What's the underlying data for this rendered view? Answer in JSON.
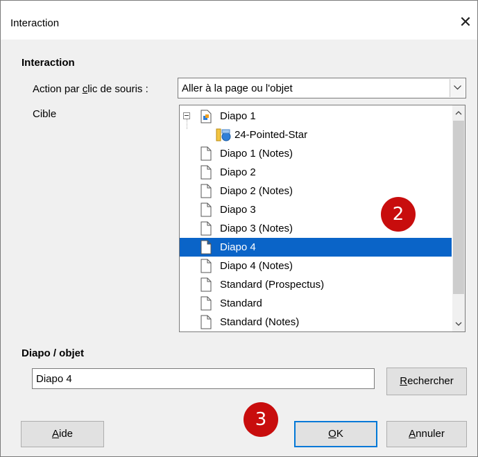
{
  "window": {
    "title": "Interaction",
    "close_glyph": "✕"
  },
  "interaction_section": {
    "heading": "Interaction"
  },
  "action": {
    "label_pre": "Action par ",
    "label_accel": "c",
    "label_post": "lic de souris :",
    "value": "Aller à la page ou l'objet"
  },
  "target": {
    "label": "Cible",
    "items": [
      {
        "label": "Diapo 1",
        "icon": "slide-icon",
        "level": 0,
        "expanded": true,
        "selected": false
      },
      {
        "label": "24-Pointed-Star",
        "icon": "shape-object-icon",
        "level": 1,
        "selected": false
      },
      {
        "label": "Diapo 1 (Notes)",
        "icon": "page-icon",
        "level": 0,
        "selected": false
      },
      {
        "label": "Diapo 2",
        "icon": "page-icon",
        "level": 0,
        "selected": false
      },
      {
        "label": "Diapo 2 (Notes)",
        "icon": "page-icon",
        "level": 0,
        "selected": false
      },
      {
        "label": "Diapo 3",
        "icon": "page-icon",
        "level": 0,
        "selected": false
      },
      {
        "label": "Diapo 3 (Notes)",
        "icon": "page-icon",
        "level": 0,
        "selected": false
      },
      {
        "label": "Diapo 4",
        "icon": "page-icon",
        "level": 0,
        "selected": true
      },
      {
        "label": "Diapo 4 (Notes)",
        "icon": "page-icon",
        "level": 0,
        "selected": false
      },
      {
        "label": "Standard (Prospectus)",
        "icon": "page-icon",
        "level": 0,
        "selected": false
      },
      {
        "label": "Standard",
        "icon": "page-icon",
        "level": 0,
        "selected": false
      },
      {
        "label": "Standard (Notes)",
        "icon": "page-icon",
        "level": 0,
        "selected": false
      }
    ]
  },
  "object_section": {
    "heading": "Diapo / objet",
    "value": "Diapo 4",
    "search_accel": "R",
    "search_rest": "echercher"
  },
  "buttons": {
    "help_accel": "A",
    "help_rest": "ide",
    "ok_accel": "O",
    "ok_rest": "K",
    "cancel_accel": "A",
    "cancel_rest": "nnuler"
  },
  "annotations": {
    "badge_2": "2",
    "badge_3": "3",
    "badge_color": "#c80d0d"
  },
  "colors": {
    "selection": "#0a64c8",
    "default_button_border": "#0078d7"
  }
}
